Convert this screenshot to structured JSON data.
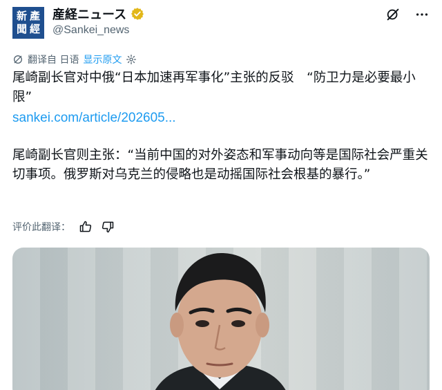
{
  "account": {
    "display_name": "産経ニュース",
    "handle": "@Sankei_news",
    "avatar_glyphs": [
      "新",
      "產",
      "聞",
      "經"
    ]
  },
  "translation": {
    "label": "翻译自 日语",
    "show_original": "显示原文"
  },
  "tweet": {
    "title": "尾崎副长官对中俄“日本加速再军事化”主张的反驳　“防卫力是必要最小限”",
    "link": "sankei.com/article/202605...",
    "body": "尾崎副长官则主张：“当前中国的对外姿态和军事动向等是国际社会严重关切事项。俄罗斯对乌克兰的侵略也是动摇国际社会根基的暴行。”"
  },
  "rating": {
    "label": "评价此翻译："
  },
  "colors": {
    "accent": "#1d9bf0",
    "secondary_text": "#536471",
    "avatar_bg": "#1f4f8f",
    "verified_gold": "#e2b719"
  },
  "icons": {
    "verified": "verified-badge-icon",
    "grok": "grok-icon",
    "more": "more-dots-icon",
    "translate": "translate-icon",
    "settings": "gear-icon",
    "thumb_up": "thumbs-up-icon",
    "thumb_down": "thumbs-down-icon"
  }
}
